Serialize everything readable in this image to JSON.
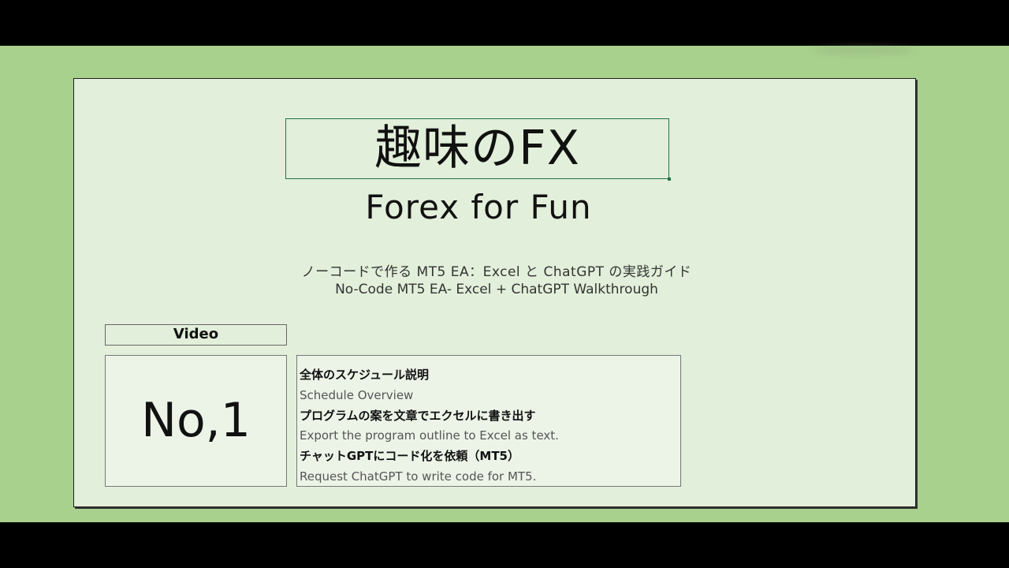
{
  "slide": {
    "title": "趣味のFX",
    "subtitle": "Forex for Fun",
    "description_jp": "ノーコードで作る MT5 EA：Excel と ChatGPT の実践ガイド",
    "description_en": "No-Code MT5 EA- Excel + ChatGPT Walkthrough",
    "video_label": "Video",
    "video_number": "No,1",
    "topics": [
      {
        "jp": "全体のスケジュール説明",
        "en": "Schedule Overview"
      },
      {
        "jp": "プログラムの案を文章でエクセルに書き出す",
        "en": "Export the program outline to Excel as text."
      },
      {
        "jp": "チャットGPTにコード化を依頼（MT5）",
        "en": "Request ChatGPT to write code for MT5."
      }
    ]
  },
  "colors": {
    "background": "#a9d18e",
    "slide": "#e2efda",
    "selection_border": "#217346"
  }
}
